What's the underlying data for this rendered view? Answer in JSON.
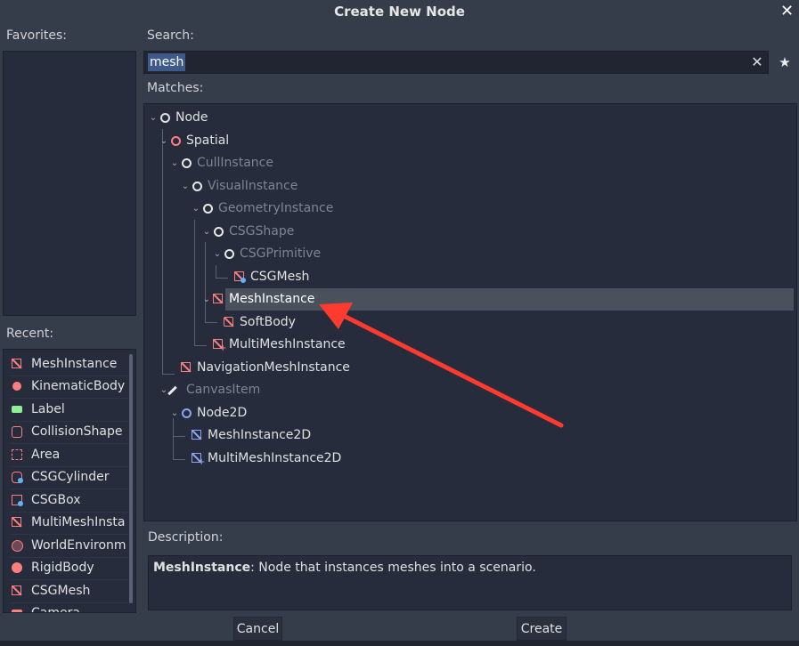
{
  "window": {
    "title": "Create New Node",
    "close_glyph": "✕"
  },
  "favorites": {
    "label": "Favorites:"
  },
  "search": {
    "label": "Search:",
    "value": "mesh",
    "clear_glyph": "✕",
    "favorite_glyph": "★"
  },
  "matches": {
    "label": "Matches:",
    "rows": [
      {
        "label": "Node",
        "icon": "circle-icon",
        "dim": false
      },
      {
        "label": "Spatial",
        "icon": "circle-icon",
        "dim": false
      },
      {
        "label": "CullInstance",
        "icon": "circle-icon",
        "dim": true
      },
      {
        "label": "VisualInstance",
        "icon": "circle-icon",
        "dim": true
      },
      {
        "label": "GeometryInstance",
        "icon": "circle-icon",
        "dim": true
      },
      {
        "label": "CSGShape",
        "icon": "circle-icon",
        "dim": true
      },
      {
        "label": "CSGPrimitive",
        "icon": "circle-icon",
        "dim": true
      },
      {
        "label": "CSGMesh",
        "icon": "csg-mesh-icon",
        "dim": false
      },
      {
        "label": "MeshInstance",
        "icon": "mesh-instance-icon",
        "dim": false,
        "selected": true
      },
      {
        "label": "SoftBody",
        "icon": "soft-body-icon",
        "dim": false
      },
      {
        "label": "MultiMeshInstance",
        "icon": "multimesh-instance-icon",
        "dim": false
      },
      {
        "label": "NavigationMeshInstance",
        "icon": "navigation-mesh-icon",
        "dim": false
      },
      {
        "label": "CanvasItem",
        "icon": "brush-icon",
        "dim": true
      },
      {
        "label": "Node2D",
        "icon": "circle-icon",
        "dim": false
      },
      {
        "label": "MeshInstance2D",
        "icon": "mesh-instance-2d-icon",
        "dim": false
      },
      {
        "label": "MultiMeshInstance2D",
        "icon": "multimesh-instance-2d-icon",
        "dim": false
      }
    ]
  },
  "recent": {
    "label": "Recent:",
    "items": [
      {
        "label": "MeshInstance",
        "icon": "mesh-instance-icon"
      },
      {
        "label": "KinematicBody",
        "icon": "kinematic-body-icon"
      },
      {
        "label": "Label",
        "icon": "label-icon"
      },
      {
        "label": "CollisionShape",
        "icon": "collision-shape-icon"
      },
      {
        "label": "Area",
        "icon": "area-icon"
      },
      {
        "label": "CSGCylinder",
        "icon": "csg-cylinder-icon"
      },
      {
        "label": "CSGBox",
        "icon": "csg-box-icon"
      },
      {
        "label": "MultiMeshInsta",
        "icon": "multimesh-instance-icon"
      },
      {
        "label": "WorldEnvironm",
        "icon": "world-environment-icon"
      },
      {
        "label": "RigidBody",
        "icon": "rigid-body-icon"
      },
      {
        "label": "CSGMesh",
        "icon": "csg-mesh-icon"
      },
      {
        "label": "Camera",
        "icon": "camera-icon"
      }
    ]
  },
  "description": {
    "label": "Description:",
    "node_name": "MeshInstance",
    "text": ": Node that instances meshes into a scenario."
  },
  "buttons": {
    "cancel": "Cancel",
    "create": "Create"
  },
  "colors": {
    "spatial": "#fc7f7f",
    "node2d": "#8da5f3",
    "accent": "#3d5a8a"
  }
}
